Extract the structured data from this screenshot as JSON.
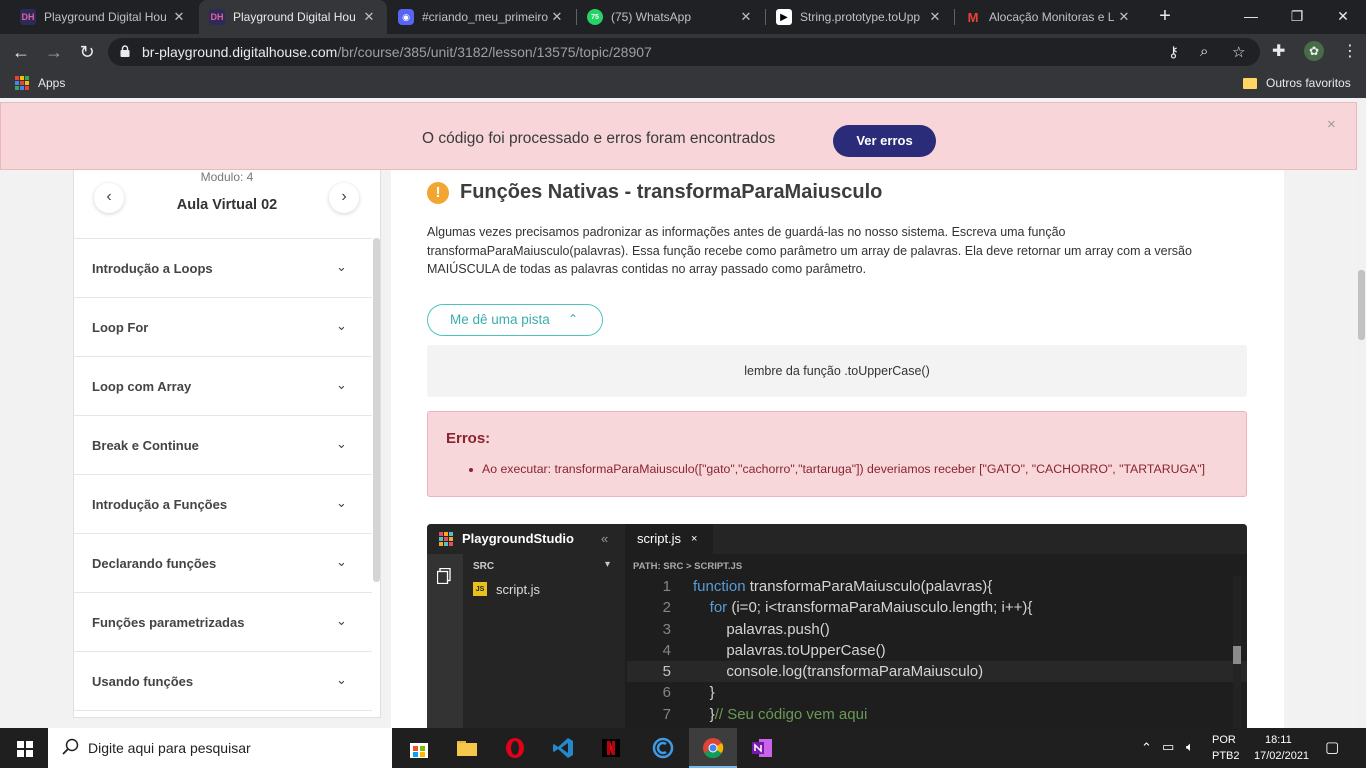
{
  "browser": {
    "tabs": [
      {
        "title": "Playground Digital Hou",
        "icon": "dh-favicon",
        "active": false
      },
      {
        "title": "Playground Digital Hou",
        "icon": "dh-favicon",
        "active": true
      },
      {
        "title": "#criando_meu_primeiro",
        "icon": "discord-icon",
        "active": false
      },
      {
        "title": "(75) WhatsApp",
        "icon": "whatsapp-icon",
        "badge": "75",
        "active": false
      },
      {
        "title": "String.prototype.toUpp",
        "icon": "mdn-icon",
        "active": false
      },
      {
        "title": "Alocação Monitoras e L",
        "icon": "gmail-icon",
        "active": false
      }
    ],
    "url_host": "br-playground.digitalhouse.com",
    "url_path": "/br/course/385/unit/3182/lesson/13575/topic/28907",
    "bookmarks": {
      "apps": "Apps",
      "other": "Outros favoritos"
    }
  },
  "banner": {
    "message": "O código foi processado e erros foram encontrados",
    "button": "Ver erros",
    "close": "×"
  },
  "sidebar": {
    "module": "Modulo: 4",
    "lesson": "Aula Virtual 02",
    "prev": "‹",
    "next": "›",
    "topics": [
      "Introdução a Loops",
      "Loop For",
      "Loop com Array",
      "Break e Continue",
      "Introdução a Funções",
      "Declarando funções",
      "Funções parametrizadas",
      "Usando funções"
    ]
  },
  "exercise": {
    "title": "Funções Nativas - transformaParaMaiusculo",
    "description": "Algumas vezes precisamos padronizar as informações antes de guardá-las no nosso sistema. Escreva uma função transformaParaMaiusculo(palavras). Essa função recebe como parâmetro um array de palavras. Ela deve retornar um array com a versão MAIÚSCULA de todas as palavras contidas no array passado como parâmetro.",
    "hint_button": "Me dê uma pista",
    "hint_text": "lembre da função .toUpperCase()",
    "errors_title": "Erros:",
    "errors": [
      "Ao executar: transformaParaMaiusculo([\"gato\",\"cachorro\",\"tartaruga\"]) deveriamos receber [\"GATO\", \"CACHORRO\", \"TARTARUGA\"]"
    ]
  },
  "studio": {
    "name": "PlaygroundStudio",
    "collapse": "«",
    "tab": "script.js",
    "tab_close": "×",
    "folder": "SRC",
    "file": "script.js",
    "path": "PATH: SRC > SCRIPT.JS",
    "lines": [
      {
        "no": "1",
        "kw": "function",
        "text": " transformaParaMaiusculo(palavras){",
        "indent": "",
        "comment": ""
      },
      {
        "no": "2",
        "kw": "for",
        "text": " (i=0; i<transformaParaMaiusculo.length; i++){",
        "indent": "    ",
        "comment": ""
      },
      {
        "no": "3",
        "kw": "",
        "text": "palavras.push()",
        "indent": "        ",
        "comment": ""
      },
      {
        "no": "4",
        "kw": "",
        "text": "palavras.toUpperCase()",
        "indent": "        ",
        "comment": ""
      },
      {
        "no": "5",
        "kw": "",
        "text": "console.log(transformaParaMaiusculo)",
        "indent": "        ",
        "comment": ""
      },
      {
        "no": "6",
        "kw": "",
        "text": "}",
        "indent": "    ",
        "comment": ""
      },
      {
        "no": "7",
        "kw": "",
        "text": "}",
        "indent": "    ",
        "comment": "// Seu código vem aqui"
      }
    ]
  },
  "taskbar": {
    "search_placeholder": "Digite aqui para pesquisar",
    "lang": "POR",
    "layout": "PTB2",
    "time": "18:11",
    "date": "17/02/2021"
  }
}
